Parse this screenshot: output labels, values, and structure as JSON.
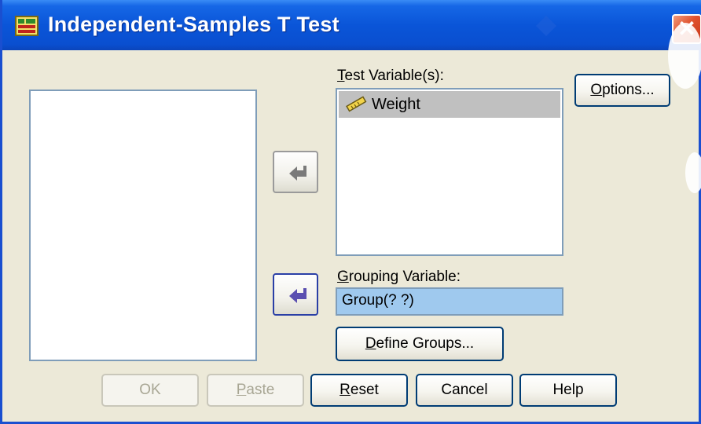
{
  "window": {
    "title": "Independent-Samples T Test",
    "close_symbol": "✕"
  },
  "icons": {
    "app": "spss-dialog-icon",
    "variable": "ruler-scale-icon",
    "arrow": "arrow-left-bent-icon"
  },
  "source_list": {
    "items": []
  },
  "test_variables": {
    "label_prefix": "T",
    "label_rest": "est Variable(s):",
    "items": [
      {
        "label": "Weight"
      }
    ]
  },
  "grouping": {
    "label_prefix": "G",
    "label_rest": "rouping Variable:",
    "value": "Group(? ?)"
  },
  "buttons": {
    "options_prefix": "O",
    "options_rest": "ptions...",
    "define_prefix": "D",
    "define_rest": "efine Groups...",
    "ok": "OK",
    "paste_prefix": "P",
    "paste_rest": "aste",
    "reset_prefix": "R",
    "reset_rest": "eset",
    "cancel": "Cancel",
    "help": "Help"
  },
  "colors": {
    "title_bar": "#0a4fd0",
    "field_highlight": "#9fc9ee",
    "selected_item": "#c0c0c0",
    "arrow_active": "#5a4fb0",
    "arrow_inactive": "#7a7a7a"
  }
}
